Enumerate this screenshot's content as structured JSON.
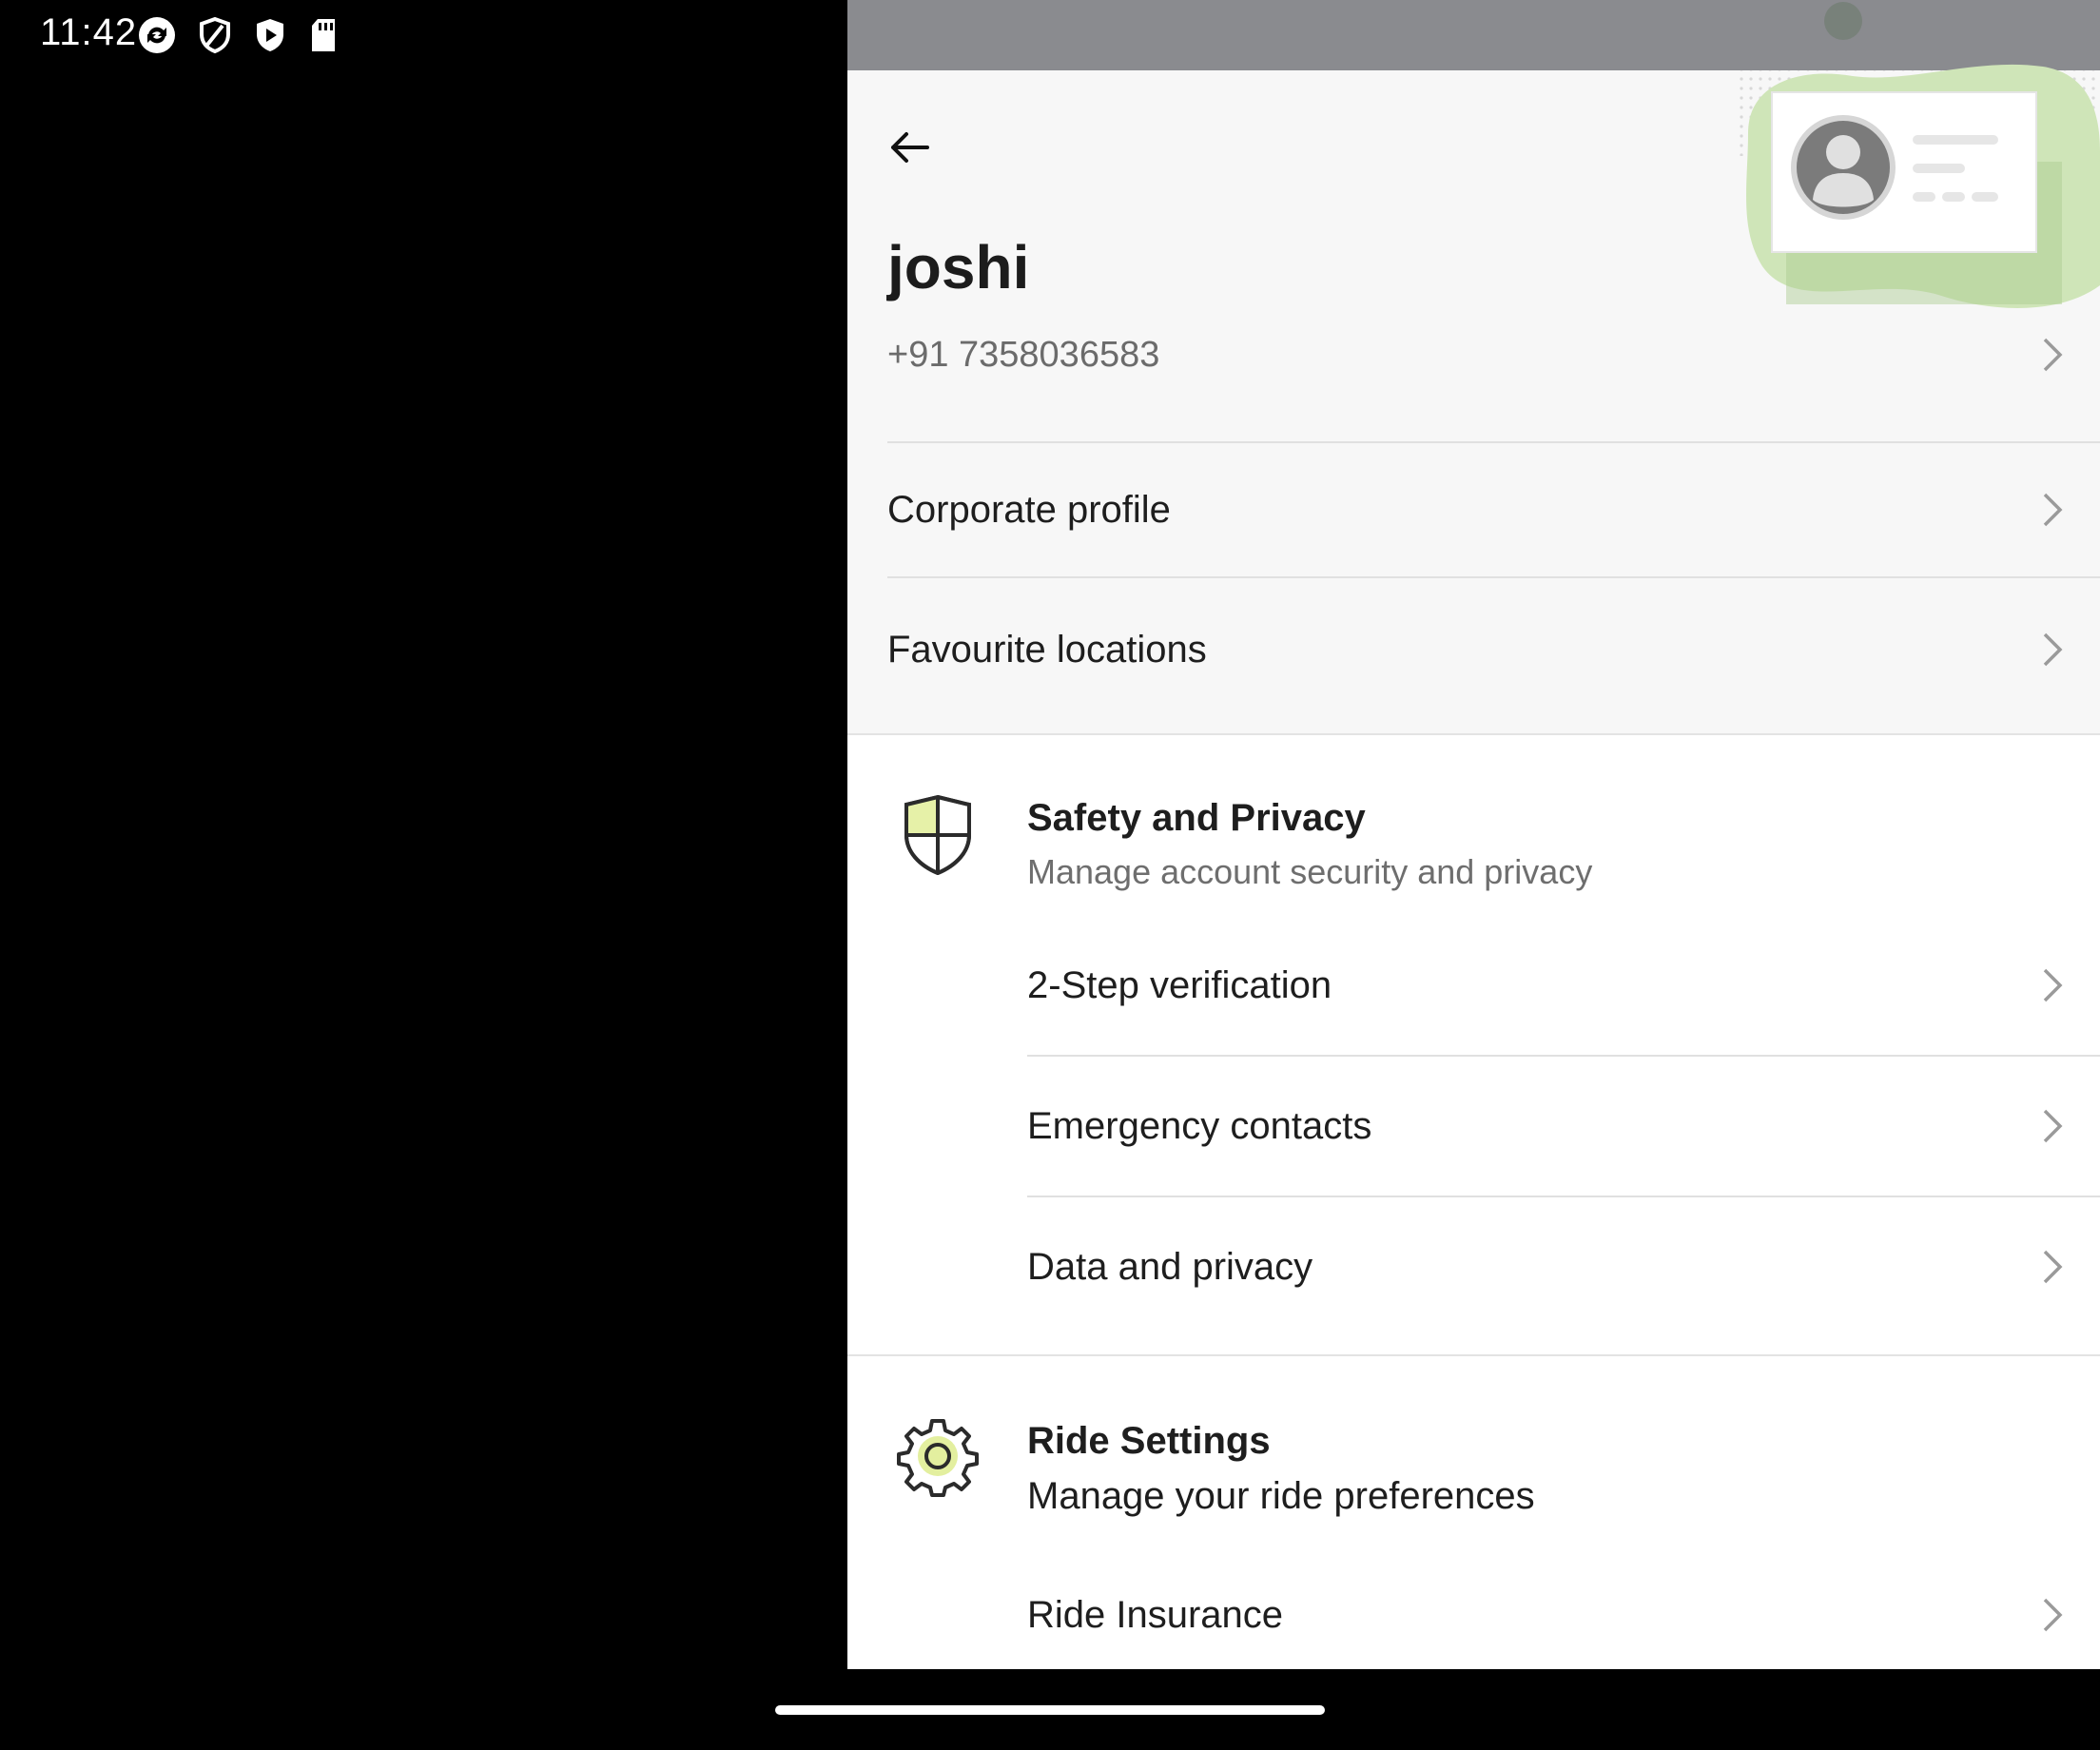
{
  "status_bar": {
    "time": "11:42",
    "left_icons": [
      "sync-icon",
      "shield-icon",
      "play-shield-icon",
      "sd-card-icon"
    ],
    "right_icons": [
      "wifi-icon",
      "signal-icon",
      "battery-icon"
    ]
  },
  "profile": {
    "name": "joshi",
    "phone": "+91 7358036583"
  },
  "menu": {
    "corporate_profile": "Corporate profile",
    "favourite_locations": "Favourite locations"
  },
  "safety": {
    "title": "Safety and Privacy",
    "subtitle": "Manage account security and privacy",
    "items": [
      {
        "label": "2-Step verification"
      },
      {
        "label": "Emergency contacts"
      },
      {
        "label": "Data and privacy"
      }
    ]
  },
  "ride": {
    "title": "Ride Settings",
    "subtitle": "Manage your ride preferences",
    "items": [
      {
        "label": "Ride Insurance"
      }
    ]
  },
  "colors": {
    "accent_green": "#cfe5b8",
    "accent_yellow": "#e3ef9f",
    "header_bg": "#f7f7f7",
    "status_gray": "#8a8b8f"
  }
}
